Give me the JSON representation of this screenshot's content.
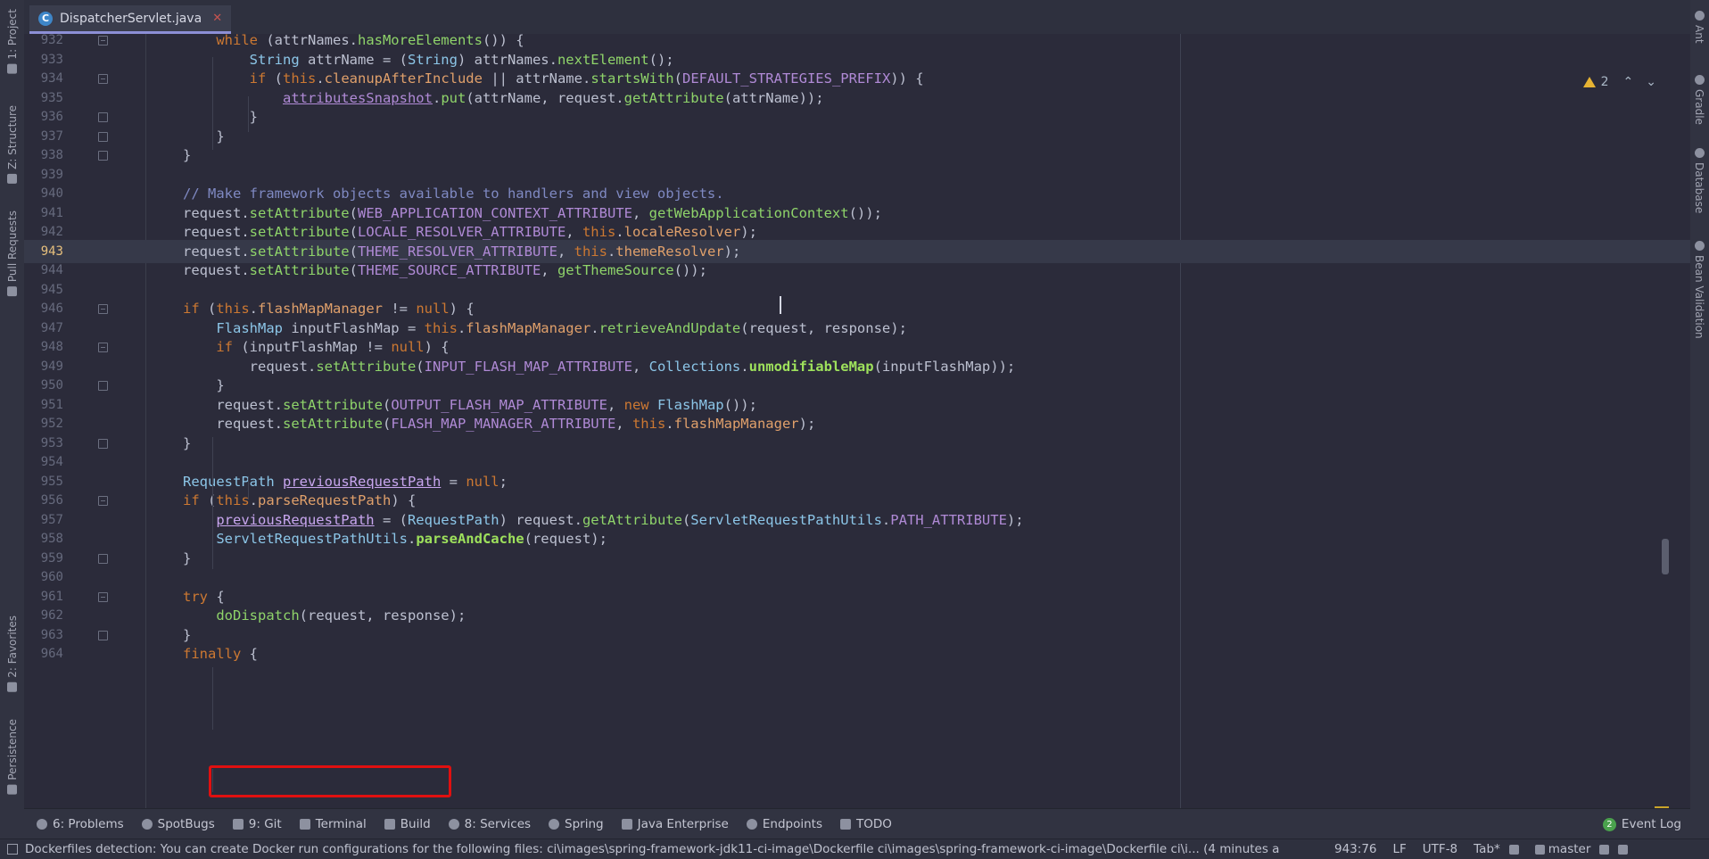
{
  "tabs": [
    {
      "label": "DispatcherServlet.java",
      "icon": "C"
    }
  ],
  "left_tools": [
    {
      "label": "1: Project",
      "icon": "folder-icon"
    },
    {
      "label": "Z: Structure",
      "icon": "structure-icon"
    },
    {
      "label": "Pull Requests",
      "icon": "pull-request-icon"
    },
    {
      "label": "2: Favorites",
      "icon": "star-icon"
    },
    {
      "label": "Persistence",
      "icon": "persistence-icon"
    }
  ],
  "right_tools": [
    {
      "label": "Ant",
      "icon": "ant-icon"
    },
    {
      "label": "Gradle",
      "icon": "gradle-icon"
    },
    {
      "label": "Database",
      "icon": "database-icon"
    },
    {
      "label": "Bean Validation",
      "icon": "bean-validation-icon"
    }
  ],
  "inspection": {
    "warning_count": "2",
    "up": "⌃",
    "down": "⌄"
  },
  "code_lines": [
    {
      "n": "932",
      "html": "    <span class='kw'>while</span> (attrNames.<span class='fn'>hasMoreElements</span>()) {"
    },
    {
      "n": "933",
      "html": "        <span class='typ'>String</span> attrName = (<span class='typ'>String</span>) attrNames.<span class='fn'>nextElement</span>();"
    },
    {
      "n": "934",
      "html": "        <span class='kw'>if</span> (<span class='kw'>this</span>.<span class='fld'>cleanupAfterInclude</span> || attrName.<span class='fn'>startsWith</span>(<span class='cst'>DEFAULT_STRATEGIES_PREFIX</span>)) {"
    },
    {
      "n": "935",
      "html": "            <span class='var'>attributesSnapshot</span>.<span class='fn'>put</span>(attrName, request.<span class='fn'>getAttribute</span>(attrName));"
    },
    {
      "n": "936",
      "html": "        }"
    },
    {
      "n": "937",
      "html": "    }"
    },
    {
      "n": "938",
      "html": "}"
    },
    {
      "n": "939",
      "html": ""
    },
    {
      "n": "940",
      "html": "<span class='cmt'>// Make framework objects available to handlers and view objects.</span>"
    },
    {
      "n": "941",
      "html": "request.<span class='fn'>setAttribute</span>(<span class='cst'>WEB_APPLICATION_CONTEXT_ATTRIBUTE</span>, <span class='fn'>getWebApplicationContext</span>());"
    },
    {
      "n": "942",
      "html": "request.<span class='fn'>setAttribute</span>(<span class='cst'>LOCALE_RESOLVER_ATTRIBUTE</span>, <span class='kw'>this</span>.<span class='fld'>localeResolver</span>);"
    },
    {
      "n": "943",
      "html": "request.<span class='fn'>setAttribute</span>(<span class='cst'>THEME_RESOLVER_ATTRIBUTE</span>, <span class='kw'>this</span>.<span class='fld'>themeResolver</span>);",
      "current": true
    },
    {
      "n": "944",
      "html": "request.<span class='fn'>setAttribute</span>(<span class='cst'>THEME_SOURCE_ATTRIBUTE</span>, <span class='fn'>getThemeSource</span>());"
    },
    {
      "n": "945",
      "html": ""
    },
    {
      "n": "946",
      "html": "<span class='kw'>if</span> (<span class='kw'>this</span>.<span class='fld'>flashMapManager</span> != <span class='kw'>null</span>) {"
    },
    {
      "n": "947",
      "html": "    <span class='typ'>FlashMap</span> inputFlashMap = <span class='kw'>this</span>.<span class='fld'>flashMapManager</span>.<span class='fn'>retrieveAndUpdate</span>(request, response);"
    },
    {
      "n": "948",
      "html": "    <span class='kw'>if</span> (inputFlashMap != <span class='kw'>null</span>) {"
    },
    {
      "n": "949",
      "html": "        request.<span class='fn'>setAttribute</span>(<span class='cst'>INPUT_FLASH_MAP_ATTRIBUTE</span>, <span class='typ'>Collections</span>.<span class='fnb'>unmodifiableMap</span>(inputFlashMap));"
    },
    {
      "n": "950",
      "html": "    }"
    },
    {
      "n": "951",
      "html": "    request.<span class='fn'>setAttribute</span>(<span class='cst'>OUTPUT_FLASH_MAP_ATTRIBUTE</span>, <span class='kw'>new</span> <span class='typ'>FlashMap</span>());"
    },
    {
      "n": "952",
      "html": "    request.<span class='fn'>setAttribute</span>(<span class='cst'>FLASH_MAP_MANAGER_ATTRIBUTE</span>, <span class='kw'>this</span>.<span class='fld'>flashMapManager</span>);"
    },
    {
      "n": "953",
      "html": "}"
    },
    {
      "n": "954",
      "html": ""
    },
    {
      "n": "955",
      "html": "<span class='typ'>RequestPath</span> <span class='var2'>previousRequestPath</span> = <span class='kw'>null</span>;"
    },
    {
      "n": "956",
      "html": "<span class='kw'>if</span> (<span class='kw'>this</span>.<span class='fld'>parseRequestPath</span>) {"
    },
    {
      "n": "957",
      "html": "    <span class='var2'>previousRequestPath</span> = (<span class='typ'>RequestPath</span>) request.<span class='fn'>getAttribute</span>(<span class='typ'>ServletRequestPathUtils</span>.<span class='cst'>PATH_ATTRIBUTE</span>);"
    },
    {
      "n": "958",
      "html": "    <span class='typ'>ServletRequestPathUtils</span>.<span class='fnb'>parseAndCache</span>(request);"
    },
    {
      "n": "959",
      "html": "}"
    },
    {
      "n": "960",
      "html": ""
    },
    {
      "n": "961",
      "html": "<span class='kw'>try</span> {"
    },
    {
      "n": "962",
      "html": "    <span class='fn'>doDispatch</span>(request, response);"
    },
    {
      "n": "963",
      "html": "}"
    },
    {
      "n": "964",
      "html": "<span class='kw'>finally</span> {"
    }
  ],
  "tool_windows": [
    {
      "label": "6: Problems",
      "icon": "problems-icon"
    },
    {
      "label": "SpotBugs",
      "icon": "spotbugs-icon"
    },
    {
      "label": "9: Git",
      "icon": "git-icon"
    },
    {
      "label": "Terminal",
      "icon": "terminal-icon"
    },
    {
      "label": "Build",
      "icon": "build-icon"
    },
    {
      "label": "8: Services",
      "icon": "services-icon"
    },
    {
      "label": "Spring",
      "icon": "spring-icon"
    },
    {
      "label": "Java Enterprise",
      "icon": "java-enterprise-icon"
    },
    {
      "label": "Endpoints",
      "icon": "endpoints-icon"
    },
    {
      "label": "TODO",
      "icon": "todo-icon"
    }
  ],
  "event_log": {
    "label": "Event Log",
    "count": "2"
  },
  "status": {
    "message": "Dockerfiles detection: You can create Docker run configurations for the following files: ci\\images\\spring-framework-jdk11-ci-image\\Dockerfile ci\\images\\spring-framework-ci-image\\Dockerfile ci\\i... (4 minutes a",
    "position": "943:76",
    "line_sep": "LF",
    "encoding": "UTF-8",
    "indent": "Tab*",
    "branch": "master"
  },
  "colors": {
    "accent": "#8c8fd6",
    "highlight_box": "#e01010",
    "warning": "#e6b333"
  }
}
